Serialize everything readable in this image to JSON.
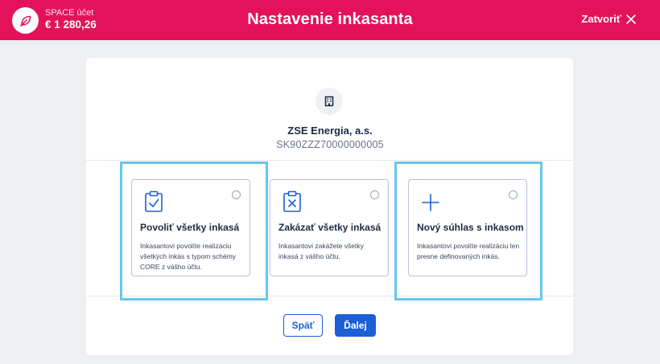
{
  "header": {
    "account_label": "SPACE účet",
    "balance": "€ 1 280,26",
    "title": "Nastavenie inkasanta",
    "close_label": "Zatvoriť",
    "brand_color": "#e4125a"
  },
  "creditor": {
    "name": "ZSE Energia, a.s.",
    "iban": "SK90ZZZ70000000005"
  },
  "options": [
    {
      "icon": "clipboard-check-icon",
      "title": "Povoliť všetky inkasá",
      "description": "Inkasantovi povolíte realizáciu všetkých inkás s typom schémy CORE z vášho účtu.",
      "highlighted": true
    },
    {
      "icon": "clipboard-x-icon",
      "title": "Zakázať všetky inkasá",
      "description": "Inkasantovi zakážete všetky inkasá z vášho účtu.",
      "highlighted": false
    },
    {
      "icon": "plus-icon",
      "title": "Nový súhlas s inkasom",
      "description": "Inkasantovi povolíte realizáciu len presne definovaných inkás.",
      "highlighted": true
    }
  ],
  "actions": {
    "back_label": "Späť",
    "next_label": "Ďalej"
  }
}
